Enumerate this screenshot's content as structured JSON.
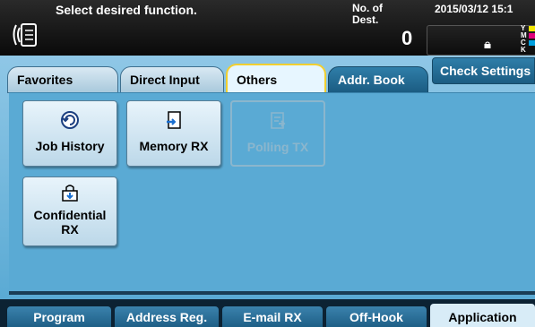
{
  "header": {
    "message": "Select desired function.",
    "dest_label_line1": "No. of",
    "dest_label_line2": "Dest.",
    "dest_count": "0",
    "datetime": "2015/03/12 15:1",
    "icons": [
      "fax-icon",
      "lock-icon"
    ],
    "toner": [
      {
        "letter": "Y",
        "color": "#f2e600"
      },
      {
        "letter": "M",
        "color": "#e0007a"
      },
      {
        "letter": "C",
        "color": "#00a0e0"
      },
      {
        "letter": "K",
        "color": "#111111"
      }
    ]
  },
  "tabs": [
    {
      "label": "Favorites",
      "state": "normal"
    },
    {
      "label": "Direct Input",
      "state": "normal"
    },
    {
      "label": "Others",
      "state": "active"
    },
    {
      "label": "Addr. Book",
      "state": "dark"
    }
  ],
  "check_settings_label": "Check Settings",
  "functions": [
    {
      "label": "Job History",
      "icon": "job-history-icon",
      "enabled": true
    },
    {
      "label": "Memory RX",
      "icon": "memory-rx-icon",
      "enabled": true
    },
    {
      "label": "Polling TX",
      "icon": "polling-tx-icon",
      "enabled": false
    },
    {
      "label": "Confidential RX",
      "icon": "confidential-rx-icon",
      "enabled": true
    }
  ],
  "bottom_tabs": [
    {
      "label": "Program",
      "active": false
    },
    {
      "label": "Address Reg.",
      "active": false
    },
    {
      "label": "E-mail RX",
      "active": false
    },
    {
      "label": "Off-Hook",
      "active": false
    },
    {
      "label": "Application",
      "active": true
    }
  ],
  "colors": {
    "accent_blue": "#5aaad4",
    "active_tab_border": "#f2cf2f",
    "dark_blue": "#1b5c82"
  }
}
